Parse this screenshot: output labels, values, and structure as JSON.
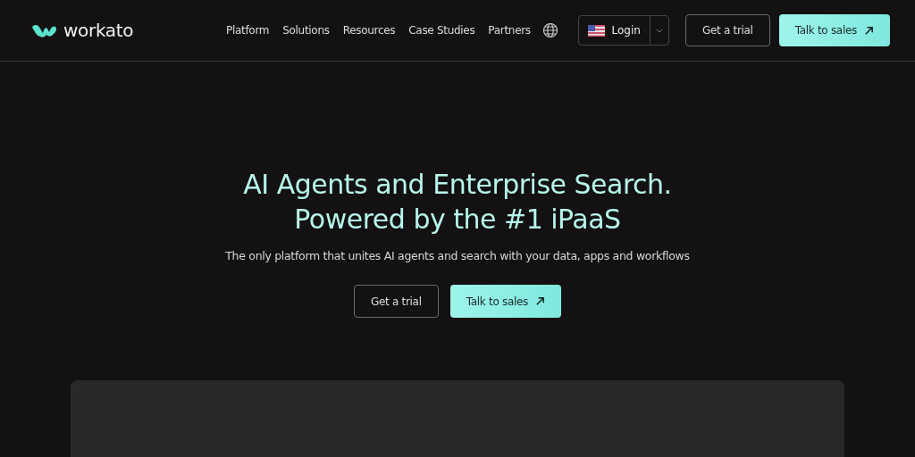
{
  "header": {
    "logo": "workato",
    "nav": [
      "Platform",
      "Solutions",
      "Resources",
      "Case Studies",
      "Partners"
    ],
    "login": "Login",
    "buttons": [
      {
        "kind": "outline",
        "label": "Get a trial"
      },
      {
        "kind": "primary",
        "label": "Talk to sales"
      }
    ]
  },
  "hero": {
    "headline": [
      "AI Agents and Enterprise Search.",
      "Powered by the #1 iPaaS"
    ],
    "subtitle": "The only platform that unites AI agents and search with your data, apps and workflows",
    "buttons": [
      {
        "kind": "outline",
        "label": "Get a trial"
      },
      {
        "kind": "primary",
        "label": "Talk to sales"
      }
    ]
  }
}
